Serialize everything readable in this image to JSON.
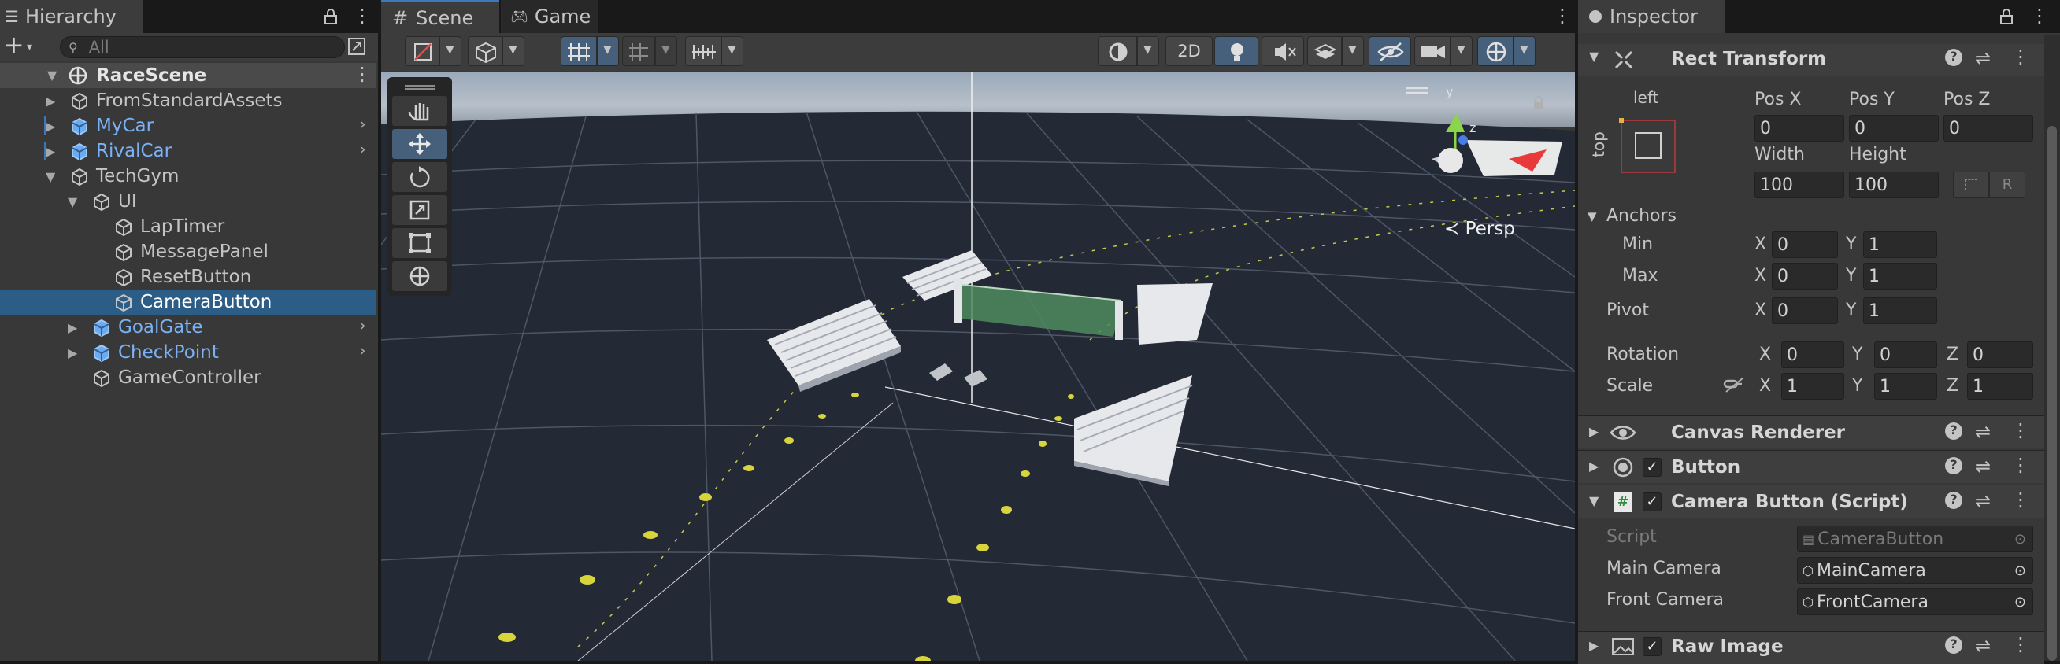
{
  "hierarchy": {
    "tab_label": "Hierarchy",
    "search_placeholder": "All",
    "scene_name": "RaceScene",
    "items": [
      {
        "label": "FromStandardAssets",
        "kind": "gray"
      },
      {
        "label": "MyCar",
        "kind": "prefab"
      },
      {
        "label": "RivalCar",
        "kind": "prefab"
      },
      {
        "label": "TechGym",
        "kind": "gray"
      },
      {
        "label": "UI",
        "kind": "gray"
      },
      {
        "label": "LapTimer",
        "kind": "gray"
      },
      {
        "label": "MessagePanel",
        "kind": "gray"
      },
      {
        "label": "ResetButton",
        "kind": "gray"
      },
      {
        "label": "CameraButton",
        "kind": "selected"
      },
      {
        "label": "GoalGate",
        "kind": "prefab"
      },
      {
        "label": "CheckPoint",
        "kind": "prefab"
      },
      {
        "label": "GameController",
        "kind": "gray"
      }
    ]
  },
  "scene": {
    "tab_scene": "Scene",
    "tab_game": "Game",
    "btn_2d": "2D",
    "persp_label": "Persp",
    "gizmo_y": "y",
    "gizmo_z": "z"
  },
  "inspector": {
    "tab_label": "Inspector",
    "rect_transform": {
      "title": "Rect Transform",
      "anchor_h_label": "left",
      "anchor_v_label": "top",
      "posx_label": "Pos X",
      "posy_label": "Pos Y",
      "posz_label": "Pos Z",
      "posx": "0",
      "posy": "0",
      "posz": "0",
      "width_label": "Width",
      "height_label": "Height",
      "width": "100",
      "height": "100",
      "r_button": "R",
      "anchors_label": "Anchors",
      "min_label": "Min",
      "max_label": "Max",
      "pivot_label": "Pivot",
      "x_label": "X",
      "y_label": "Y",
      "z_label": "Z",
      "min_x": "0",
      "min_y": "1",
      "max_x": "0",
      "max_y": "1",
      "pivot_x": "0",
      "pivot_y": "1",
      "rotation_label": "Rotation",
      "rot_x": "0",
      "rot_y": "0",
      "rot_z": "0",
      "scale_label": "Scale",
      "scale_x": "1",
      "scale_y": "1",
      "scale_z": "1"
    },
    "canvas_renderer": "Canvas Renderer",
    "button": "Button",
    "camera_button_script": {
      "title": "Camera Button (Script)",
      "script_label": "Script",
      "script_value": "CameraButton",
      "main_camera_label": "Main Camera",
      "main_camera_value": "MainCamera",
      "front_camera_label": "Front Camera",
      "front_camera_value": "FrontCamera"
    },
    "raw_image": "Raw Image"
  },
  "colors": {
    "accent": "#3a79bb",
    "selected_row": "#2c5d87",
    "prefab_text": "#7bb2f5"
  }
}
